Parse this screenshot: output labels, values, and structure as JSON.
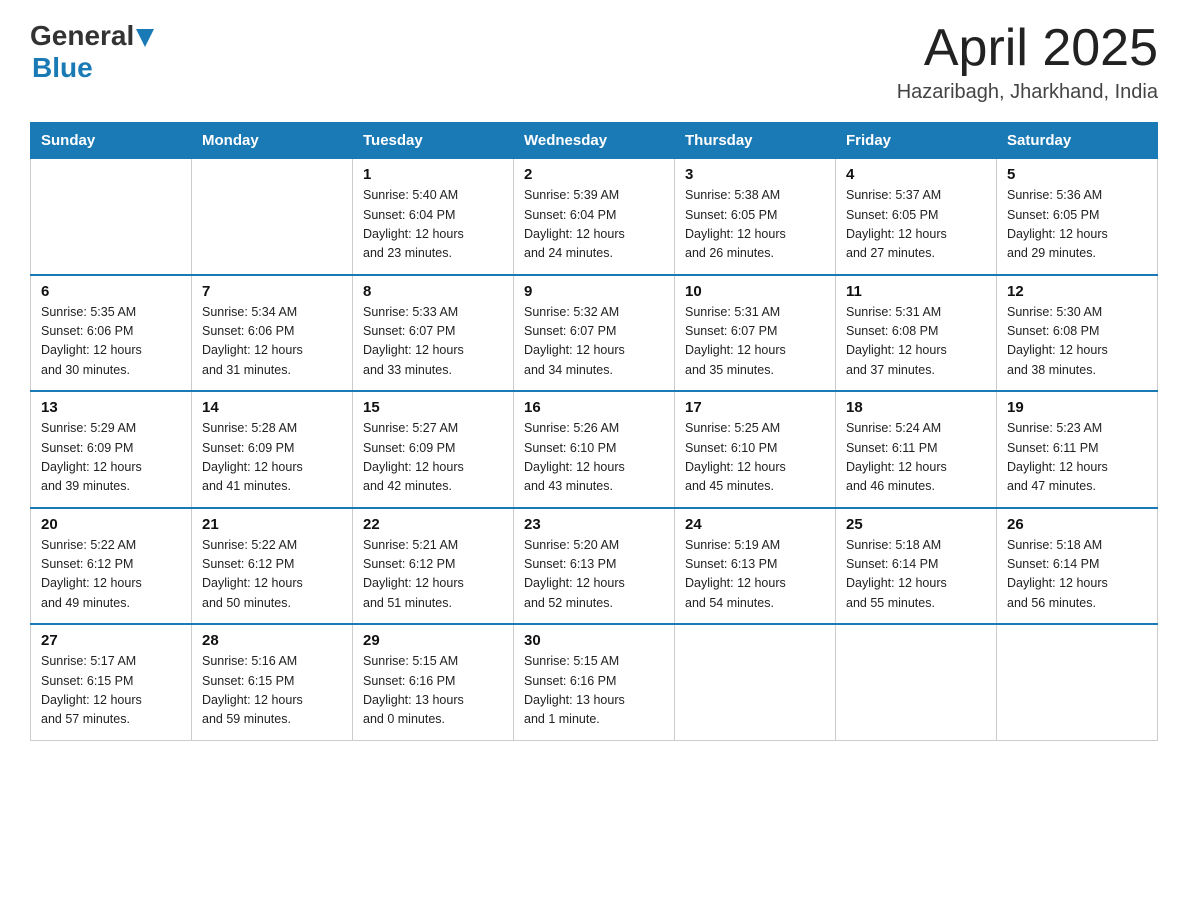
{
  "header": {
    "logo_general": "General",
    "logo_blue": "Blue",
    "month_title": "April 2025",
    "location": "Hazaribagh, Jharkhand, India"
  },
  "days_of_week": [
    "Sunday",
    "Monday",
    "Tuesday",
    "Wednesday",
    "Thursday",
    "Friday",
    "Saturday"
  ],
  "weeks": [
    {
      "days": [
        {
          "num": "",
          "info": ""
        },
        {
          "num": "",
          "info": ""
        },
        {
          "num": "1",
          "info": "Sunrise: 5:40 AM\nSunset: 6:04 PM\nDaylight: 12 hours\nand 23 minutes."
        },
        {
          "num": "2",
          "info": "Sunrise: 5:39 AM\nSunset: 6:04 PM\nDaylight: 12 hours\nand 24 minutes."
        },
        {
          "num": "3",
          "info": "Sunrise: 5:38 AM\nSunset: 6:05 PM\nDaylight: 12 hours\nand 26 minutes."
        },
        {
          "num": "4",
          "info": "Sunrise: 5:37 AM\nSunset: 6:05 PM\nDaylight: 12 hours\nand 27 minutes."
        },
        {
          "num": "5",
          "info": "Sunrise: 5:36 AM\nSunset: 6:05 PM\nDaylight: 12 hours\nand 29 minutes."
        }
      ]
    },
    {
      "days": [
        {
          "num": "6",
          "info": "Sunrise: 5:35 AM\nSunset: 6:06 PM\nDaylight: 12 hours\nand 30 minutes."
        },
        {
          "num": "7",
          "info": "Sunrise: 5:34 AM\nSunset: 6:06 PM\nDaylight: 12 hours\nand 31 minutes."
        },
        {
          "num": "8",
          "info": "Sunrise: 5:33 AM\nSunset: 6:07 PM\nDaylight: 12 hours\nand 33 minutes."
        },
        {
          "num": "9",
          "info": "Sunrise: 5:32 AM\nSunset: 6:07 PM\nDaylight: 12 hours\nand 34 minutes."
        },
        {
          "num": "10",
          "info": "Sunrise: 5:31 AM\nSunset: 6:07 PM\nDaylight: 12 hours\nand 35 minutes."
        },
        {
          "num": "11",
          "info": "Sunrise: 5:31 AM\nSunset: 6:08 PM\nDaylight: 12 hours\nand 37 minutes."
        },
        {
          "num": "12",
          "info": "Sunrise: 5:30 AM\nSunset: 6:08 PM\nDaylight: 12 hours\nand 38 minutes."
        }
      ]
    },
    {
      "days": [
        {
          "num": "13",
          "info": "Sunrise: 5:29 AM\nSunset: 6:09 PM\nDaylight: 12 hours\nand 39 minutes."
        },
        {
          "num": "14",
          "info": "Sunrise: 5:28 AM\nSunset: 6:09 PM\nDaylight: 12 hours\nand 41 minutes."
        },
        {
          "num": "15",
          "info": "Sunrise: 5:27 AM\nSunset: 6:09 PM\nDaylight: 12 hours\nand 42 minutes."
        },
        {
          "num": "16",
          "info": "Sunrise: 5:26 AM\nSunset: 6:10 PM\nDaylight: 12 hours\nand 43 minutes."
        },
        {
          "num": "17",
          "info": "Sunrise: 5:25 AM\nSunset: 6:10 PM\nDaylight: 12 hours\nand 45 minutes."
        },
        {
          "num": "18",
          "info": "Sunrise: 5:24 AM\nSunset: 6:11 PM\nDaylight: 12 hours\nand 46 minutes."
        },
        {
          "num": "19",
          "info": "Sunrise: 5:23 AM\nSunset: 6:11 PM\nDaylight: 12 hours\nand 47 minutes."
        }
      ]
    },
    {
      "days": [
        {
          "num": "20",
          "info": "Sunrise: 5:22 AM\nSunset: 6:12 PM\nDaylight: 12 hours\nand 49 minutes."
        },
        {
          "num": "21",
          "info": "Sunrise: 5:22 AM\nSunset: 6:12 PM\nDaylight: 12 hours\nand 50 minutes."
        },
        {
          "num": "22",
          "info": "Sunrise: 5:21 AM\nSunset: 6:12 PM\nDaylight: 12 hours\nand 51 minutes."
        },
        {
          "num": "23",
          "info": "Sunrise: 5:20 AM\nSunset: 6:13 PM\nDaylight: 12 hours\nand 52 minutes."
        },
        {
          "num": "24",
          "info": "Sunrise: 5:19 AM\nSunset: 6:13 PM\nDaylight: 12 hours\nand 54 minutes."
        },
        {
          "num": "25",
          "info": "Sunrise: 5:18 AM\nSunset: 6:14 PM\nDaylight: 12 hours\nand 55 minutes."
        },
        {
          "num": "26",
          "info": "Sunrise: 5:18 AM\nSunset: 6:14 PM\nDaylight: 12 hours\nand 56 minutes."
        }
      ]
    },
    {
      "days": [
        {
          "num": "27",
          "info": "Sunrise: 5:17 AM\nSunset: 6:15 PM\nDaylight: 12 hours\nand 57 minutes."
        },
        {
          "num": "28",
          "info": "Sunrise: 5:16 AM\nSunset: 6:15 PM\nDaylight: 12 hours\nand 59 minutes."
        },
        {
          "num": "29",
          "info": "Sunrise: 5:15 AM\nSunset: 6:16 PM\nDaylight: 13 hours\nand 0 minutes."
        },
        {
          "num": "30",
          "info": "Sunrise: 5:15 AM\nSunset: 6:16 PM\nDaylight: 13 hours\nand 1 minute."
        },
        {
          "num": "",
          "info": ""
        },
        {
          "num": "",
          "info": ""
        },
        {
          "num": "",
          "info": ""
        }
      ]
    }
  ]
}
